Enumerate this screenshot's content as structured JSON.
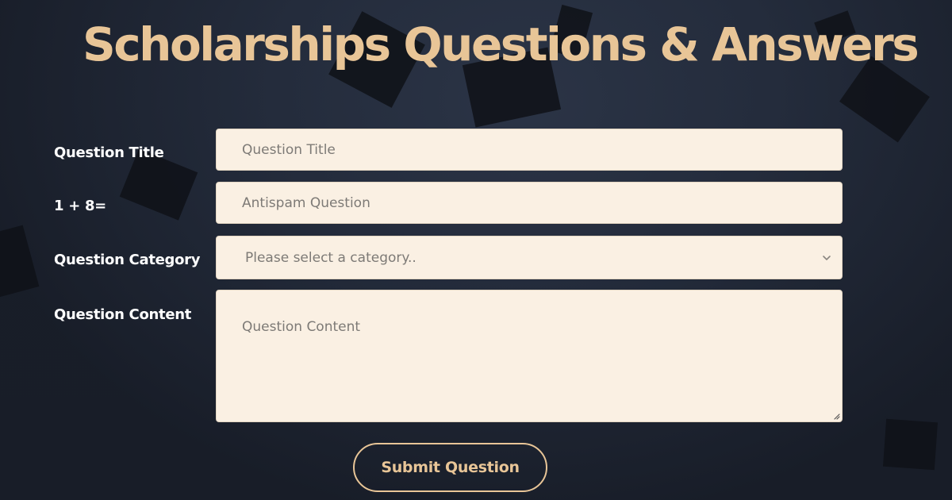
{
  "page": {
    "title": "Scholarships Questions & Answers"
  },
  "form": {
    "question_title": {
      "label": "Question Title",
      "placeholder": "Question Title"
    },
    "antispam": {
      "label": "1 + 8=",
      "placeholder": "Antispam Question"
    },
    "category": {
      "label": "Question Category",
      "selected": "Please select a category.."
    },
    "content": {
      "label": "Question Content",
      "placeholder": "Question Content"
    },
    "submit_label": "Submit Question"
  },
  "colors": {
    "accent": "#e8c597",
    "field_bg": "#faf0e3",
    "background": "#1c2230",
    "label_text": "#ffffff"
  },
  "icons": {
    "select_arrow": "chevron-down-icon",
    "resize": "resize-grip-icon"
  }
}
